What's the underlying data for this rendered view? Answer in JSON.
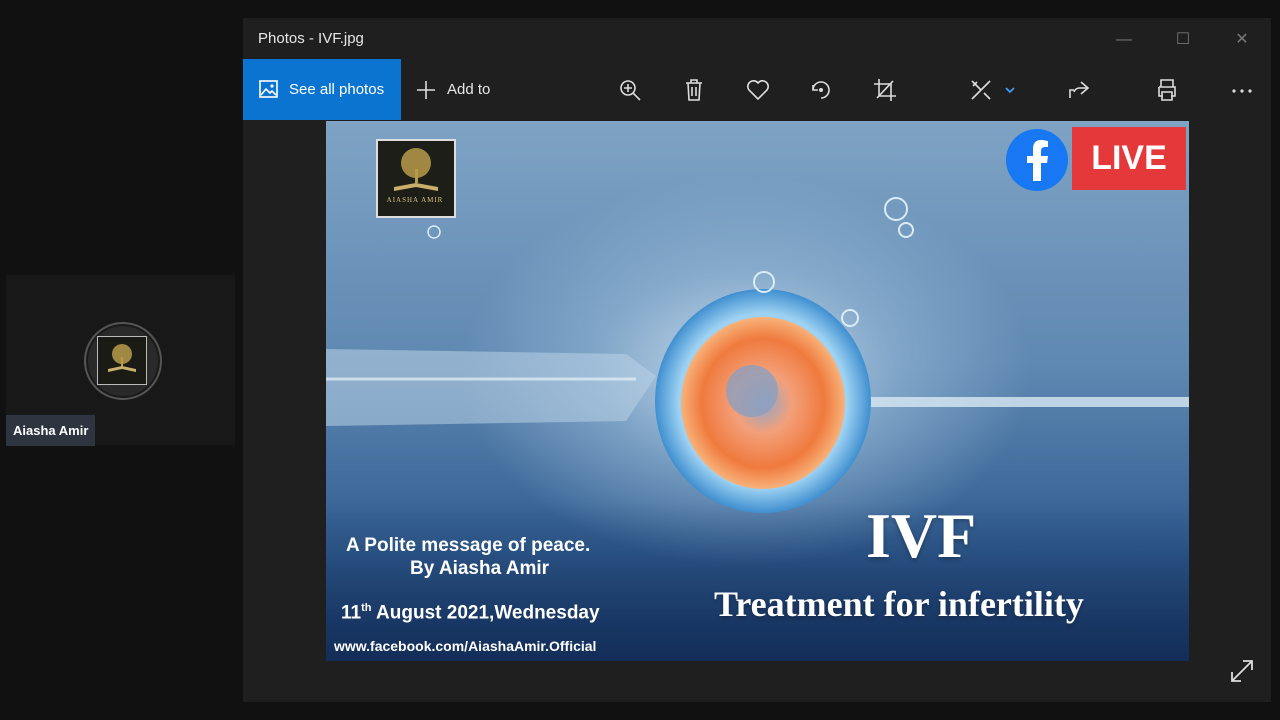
{
  "meeting": {
    "participant_name": "Aiasha Amir"
  },
  "window": {
    "title": "Photos - IVF.jpg",
    "controls": {
      "minimize": "—",
      "maximize": "☐",
      "close": "✕"
    }
  },
  "toolbar": {
    "see_all_label": "See all photos",
    "add_to_label": "Add to",
    "icons": [
      "zoom-in-icon",
      "delete-icon",
      "favorite-icon",
      "rotate-icon",
      "crop-icon",
      "edit-icon",
      "share-icon",
      "print-icon",
      "more-icon"
    ],
    "accent": "#0a74d0"
  },
  "photo": {
    "brand_name": "AIASHA AMIR",
    "live_badge": "LIVE",
    "message_line1": "A Polite message of peace.",
    "message_line2": "By Aiasha Amir",
    "date_day": "11",
    "date_suffix": "th",
    "date_rest": " August 2021,Wednesday",
    "url": "www.facebook.com/AiashaAmir.Official",
    "title": "IVF",
    "subtitle": "Treatment for infertility",
    "live_color": "#e5383b",
    "facebook_color": "#1877f2"
  }
}
